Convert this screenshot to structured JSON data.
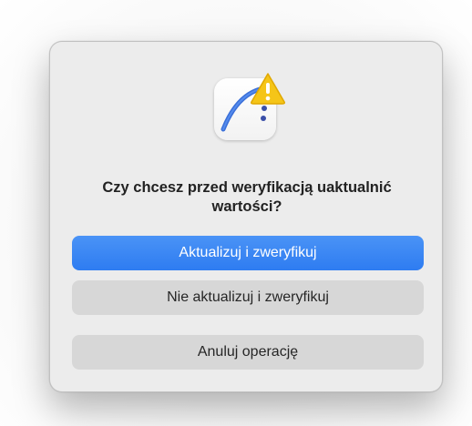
{
  "dialog": {
    "title": "Czy chcesz przed weryfikacją uaktualnić wartości?",
    "icon": "app-curve-icon",
    "badge_icon": "warning-icon",
    "colors": {
      "primary": "#2e7cf1",
      "warning": "#f5c518",
      "dialog_bg": "#ececec"
    },
    "buttons": {
      "update_and_verify": "Aktualizuj i zweryfikuj",
      "verify_without_update": "Nie aktualizuj i zweryfikuj",
      "cancel": "Anuluj operację"
    }
  }
}
